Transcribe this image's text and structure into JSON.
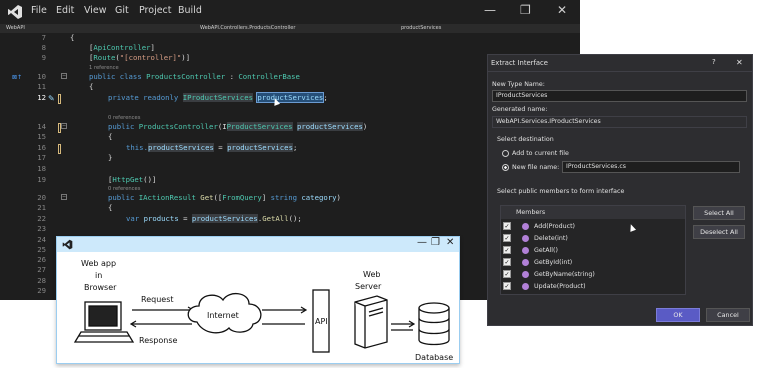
{
  "vs": {
    "menu": [
      "File",
      "Edit",
      "View",
      "Git",
      "Project",
      "Build"
    ],
    "nav": [
      "WebAPI",
      "WebAPI.Controllers.ProductsController",
      "productServices"
    ],
    "line_numbers": [
      "7",
      "8",
      "9",
      "10",
      "11",
      "12",
      "13",
      "14",
      "15",
      "16",
      "17",
      "18",
      "19",
      "20",
      "21",
      "22",
      "23",
      "24",
      "25",
      "26",
      "27",
      "28",
      "29"
    ],
    "current_line": "12",
    "ref_labels": {
      "r1": "1 reference",
      "r2": "0 references",
      "r3": "0 references"
    },
    "code": {
      "l7": "{",
      "l8a": "[",
      "l8b": "ApiController",
      "l8c": "]",
      "l9a": "[",
      "l9b": "Route",
      "l9c": "(",
      "l9d": "\"[controller]\"",
      "l9e": ")]",
      "l10a": "public class ",
      "l10b": "ProductsController",
      "l10c": " : ",
      "l10d": "ControllerBase",
      "l11": "{",
      "l12a": "private readonly ",
      "l12b": "I",
      "l12c": "ProductServices",
      "l12d": " ",
      "l12e": "productServices",
      "l12f": ";",
      "l14a": "public ",
      "l14b": "ProductsController",
      "l14c": "(I",
      "l14d": "ProductServices",
      "l14e": " ",
      "l14f": "productServices",
      "l14g": ")",
      "l15": "{",
      "l16a": "this.",
      "l16b": "productServices",
      "l16c": " = ",
      "l16d": "productServices",
      "l16e": ";",
      "l17": "}",
      "l19a": "[",
      "l19b": "HttpGet",
      "l19c": "()]",
      "l20a": "public ",
      "l20b": "IActionResult",
      "l20c": " ",
      "l20d": "Get",
      "l20e": "([",
      "l20f": "FromQuery",
      "l20g": "] ",
      "l20h": "string",
      "l20i": " ",
      "l20j": "category",
      "l20k": ")",
      "l21": "{",
      "l22a": "var ",
      "l22b": "products",
      "l22c": " = ",
      "l22d": "productServices",
      ".": ".",
      "l22e": "GetAll",
      "l22f": "();"
    }
  },
  "dialog": {
    "title": "Extract Interface",
    "help": "?",
    "close": "✕",
    "new_type_label": "New Type Name:",
    "new_type_value": "IProductServices",
    "generated_label": "Generated name:",
    "generated_value": "WebAPI.Services.IProductServices",
    "destination_label": "Select destination",
    "opt_current": "Add to current file",
    "opt_new": "New file name:",
    "new_file_value": "IProductServices.cs",
    "members_prompt": "Select public members to form interface",
    "members_header": "Members",
    "members": [
      "Add(Product)",
      "Delete(int)",
      "GetAll()",
      "GetById(int)",
      "GetByName(string)",
      "Update(Product)"
    ],
    "select_all": "Select All",
    "deselect_all": "Deselect All",
    "ok": "OK",
    "cancel": "Cancel"
  },
  "diagram": {
    "browser_label": [
      "Web app",
      "in",
      "Browser"
    ],
    "request": "Request",
    "response": "Response",
    "internet": "Internet",
    "api": "API",
    "server_label": [
      "Web",
      "Server"
    ],
    "database": "Database"
  },
  "colors": {
    "accent": "#569cd6",
    "type": "#4ec9b0",
    "ok_button": "#5a5bc5"
  }
}
